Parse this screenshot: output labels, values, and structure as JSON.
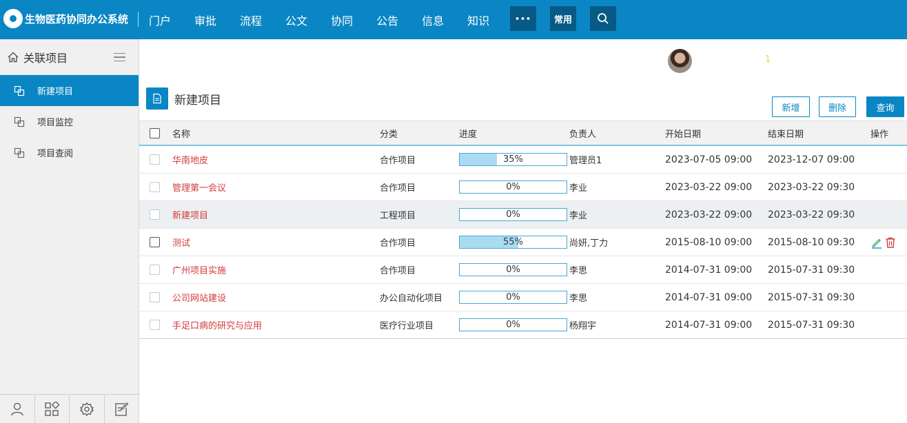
{
  "app": {
    "title": "生物医药协同办公系统",
    "nav": [
      "门户",
      "审批",
      "流程",
      "公文",
      "协同",
      "公告",
      "信息",
      "知识"
    ],
    "more_label": "•••",
    "common_label": "常用",
    "accent": "#0a86c4"
  },
  "sidebar": {
    "title": "关联项目",
    "items": [
      {
        "label": "新建项目",
        "active": true
      },
      {
        "label": "项目监控",
        "active": false
      },
      {
        "label": "项目查阅",
        "active": false
      }
    ],
    "footer_icons": [
      "user-icon",
      "apps-icon",
      "settings-icon",
      "edit-note-icon"
    ]
  },
  "header": {
    "notice_count": "1"
  },
  "page": {
    "title": "新建项目",
    "buttons": {
      "add": "新增",
      "delete": "删除",
      "query": "查询"
    }
  },
  "table": {
    "columns": [
      "名称",
      "分类",
      "进度",
      "负责人",
      "开始日期",
      "结束日期",
      "操作"
    ],
    "rows": [
      {
        "name": "华南地皮",
        "category": "合作项目",
        "progress": 35,
        "progress_label": "35%",
        "owner": "管理员1",
        "start": "2023-07-05 09:00",
        "end": "2023-12-07 09:00"
      },
      {
        "name": "管理第一会议",
        "category": "合作项目",
        "progress": 0,
        "progress_label": "0%",
        "owner": "李业",
        "start": "2023-03-22 09:00",
        "end": "2023-03-22 09:30"
      },
      {
        "name": "新建项目",
        "category": "工程项目",
        "progress": 0,
        "progress_label": "0%",
        "owner": "李业",
        "start": "2023-03-22 09:00",
        "end": "2023-03-22 09:30"
      },
      {
        "name": "测试",
        "category": "合作项目",
        "progress": 55,
        "progress_label": "55%",
        "owner": "尚妍,丁力",
        "start": "2015-08-10 09:00",
        "end": "2015-08-10 09:30"
      },
      {
        "name": "广州项目实施",
        "category": "合作项目",
        "progress": 0,
        "progress_label": "0%",
        "owner": "李思",
        "start": "2014-07-31 09:00",
        "end": "2015-07-31 09:30"
      },
      {
        "name": "公司网站建设",
        "category": "办公自动化项目",
        "progress": 0,
        "progress_label": "0%",
        "owner": "李思",
        "start": "2014-07-31 09:00",
        "end": "2015-07-31 09:30"
      },
      {
        "name": "手足口病的研究与应用",
        "category": "医疗行业项目",
        "progress": 0,
        "progress_label": "0%",
        "owner": "杨翔宇",
        "start": "2014-07-31 09:00",
        "end": "2015-07-31 09:30"
      }
    ]
  }
}
